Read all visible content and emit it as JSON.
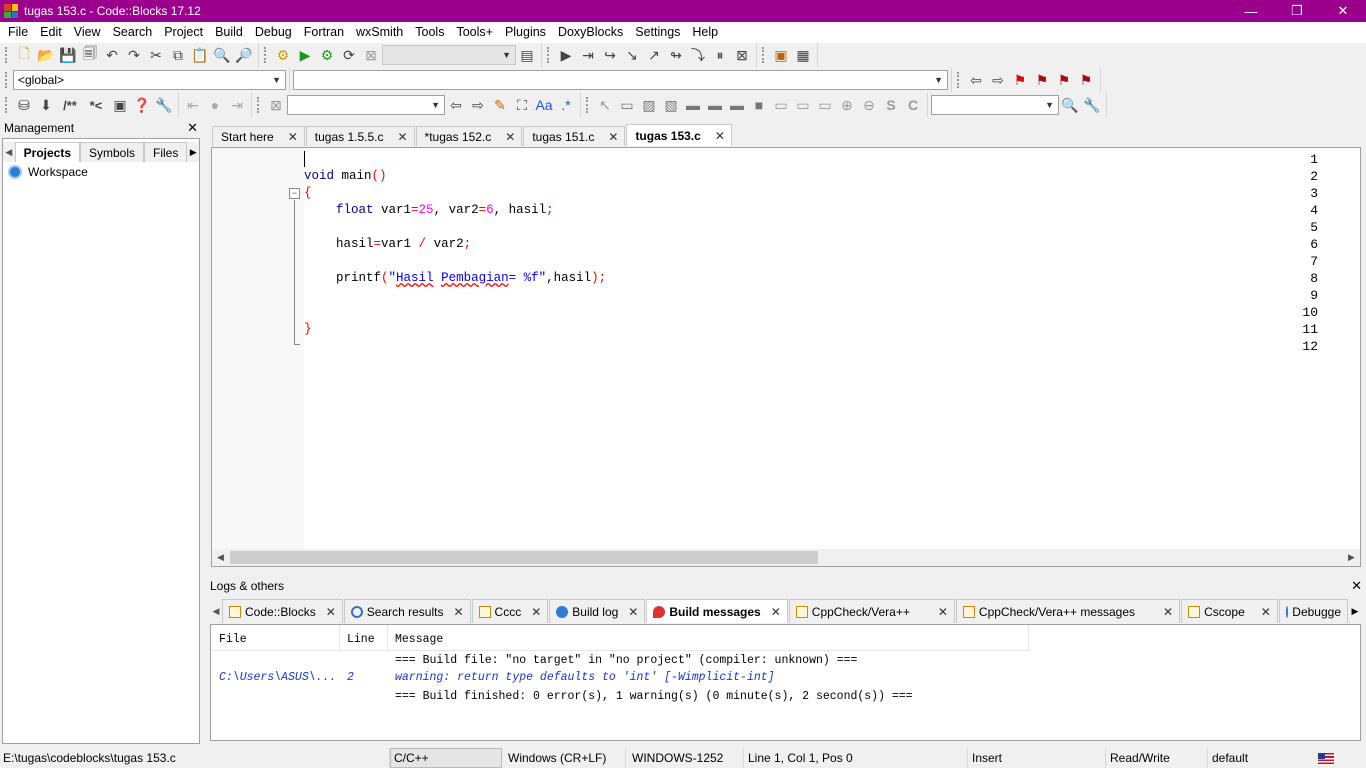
{
  "window": {
    "title": "tugas 153.c - Code::Blocks 17.12",
    "minimize": "—",
    "maximize": "❐",
    "close": "✕"
  },
  "menu": [
    "File",
    "Edit",
    "View",
    "Search",
    "Project",
    "Build",
    "Debug",
    "Fortran",
    "wxSmith",
    "Tools",
    "Tools+",
    "Plugins",
    "DoxyBlocks",
    "Settings",
    "Help"
  ],
  "toolbar": {
    "scope_combo": "<global>",
    "doxy_comment1": "/**",
    "doxy_comment2": "*<"
  },
  "management": {
    "title": "Management",
    "close": "✕",
    "tabs": [
      "Projects",
      "Symbols",
      "Files"
    ],
    "active_tab": "Projects",
    "tree": [
      {
        "label": "Workspace"
      }
    ]
  },
  "editor": {
    "tabs": [
      {
        "label": "Start here",
        "close": "✕"
      },
      {
        "label": "tugas 1.5.5.c",
        "close": "✕"
      },
      {
        "label": "*tugas 152.c",
        "close": "✕"
      },
      {
        "label": "tugas 151.c",
        "close": "✕"
      },
      {
        "label": "tugas 153.c",
        "close": "✕",
        "active": true
      }
    ],
    "line_numbers": [
      "1",
      "2",
      "3",
      "4",
      "5",
      "6",
      "7",
      "8",
      "9",
      "10",
      "11",
      "12"
    ],
    "code": {
      "l2_kw": "void",
      "l2_rest": " main",
      "l2_paren": "()",
      "l3_brace": "{",
      "l4_kw": "float",
      "l4_a": " var1",
      "l4_eq1": "=",
      "l4_n1": "25",
      "l4_b": ", var2",
      "l4_eq2": "=",
      "l4_n2": "6",
      "l4_c": ", hasil",
      "l4_semi": ";",
      "l6_a": "hasil",
      "l6_eq": "=",
      "l6_b": "var1 ",
      "l6_div": "/",
      "l6_c": " var2",
      "l6_semi": ";",
      "l8_fn": "printf",
      "l8_p1": "(",
      "l8_q1": "\"",
      "l8_w1": "Hasil",
      "l8_sp": " ",
      "l8_w2": "Pembagian",
      "l8_s": "= %f\"",
      "l8_comma": ",hasil",
      "l8_p2": ")",
      "l8_semi": ";",
      "l11_brace": "}"
    }
  },
  "logs": {
    "title": "Logs & others",
    "close": "✕",
    "tabs": [
      {
        "label": "Code::Blocks",
        "close": "✕"
      },
      {
        "label": "Search results",
        "close": "✕"
      },
      {
        "label": "Cccc",
        "close": "✕"
      },
      {
        "label": "Build log",
        "close": "✕"
      },
      {
        "label": "Build messages",
        "close": "✕",
        "active": true
      },
      {
        "label": "CppCheck/Vera++",
        "close": "✕"
      },
      {
        "label": "CppCheck/Vera++ messages",
        "close": "✕"
      },
      {
        "label": "Cscope",
        "close": "✕"
      },
      {
        "label": "Debugge",
        "close": ""
      }
    ],
    "columns": [
      "File",
      "Line",
      "Message"
    ],
    "rows": [
      {
        "file": "",
        "line": "",
        "message": "=== Build file: \"no target\" in \"no project\" (compiler: unknown) ==="
      },
      {
        "file": "C:\\Users\\ASUS\\...",
        "line": "2",
        "message": "warning: return type defaults to 'int' [-Wimplicit-int]"
      },
      {
        "file": "",
        "line": "",
        "message": "=== Build finished: 0 error(s), 1 warning(s) (0 minute(s), 2 second(s)) ==="
      }
    ]
  },
  "status": {
    "path": "E:\\tugas\\codeblocks\\tugas 153.c",
    "lang": "C/C++",
    "eol": "Windows (CR+LF)",
    "encoding": "WINDOWS-1252",
    "position": "Line 1, Col 1, Pos 0",
    "mode": "Insert",
    "access": "Read/Write",
    "profile": "default"
  },
  "colors": {
    "titlebar": "#9b008c",
    "keyword": "#00008b",
    "number": "#ff00ff",
    "operator": "#ff0000",
    "string": "#0000ff",
    "warning": "#1b37c7"
  }
}
